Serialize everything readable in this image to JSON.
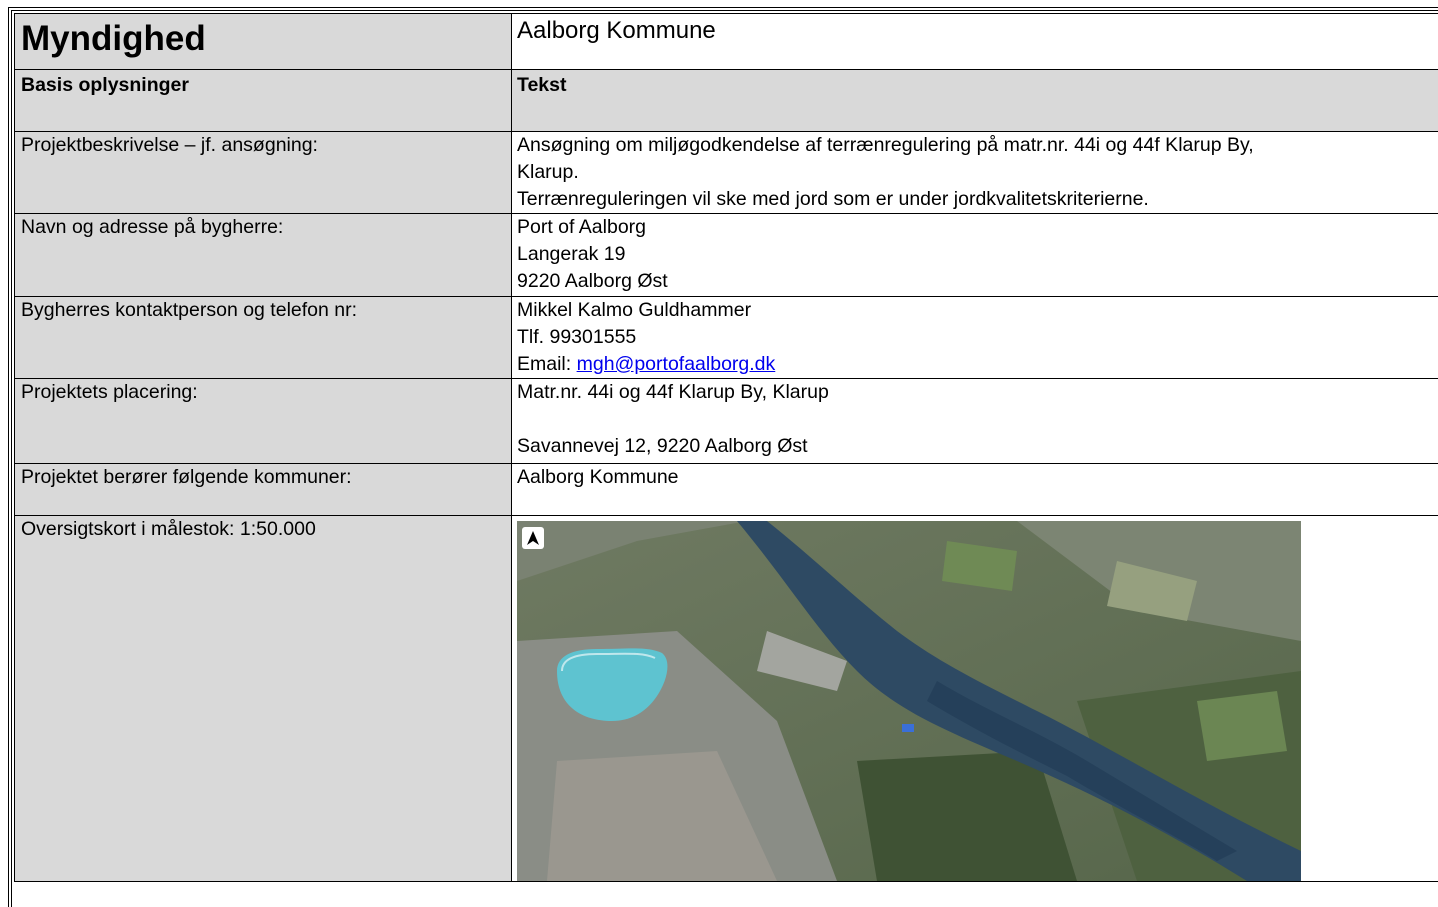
{
  "header": {
    "authority_label": "Myndighed",
    "authority_value": "Aalborg Kommune"
  },
  "subheader": {
    "left": "Basis oplysninger",
    "right": "Tekst"
  },
  "rows": {
    "description": {
      "label": "Projektbeskrivelse – jf. ansøgning:",
      "lines": [
        "Ansøgning om miljøgodkendelse af terrænregulering på matr.nr. 44i og 44f Klarup By,",
        "Klarup.",
        "Terrænreguleringen vil ske med jord som er under jordkvalitetskriterierne."
      ]
    },
    "developer": {
      "label": "Navn og adresse på bygherre:",
      "lines": [
        "Port of Aalborg",
        "Langerak 19",
        "9220 Aalborg Øst"
      ]
    },
    "contact": {
      "label": "Bygherres kontaktperson og telefon nr:",
      "name": "Mikkel Kalmo Guldhammer",
      "phone": "Tlf. 99301555",
      "email_label": "Email: ",
      "email": "mgh@portofaalborg.dk"
    },
    "placement": {
      "label": "Projektets placering:",
      "line1": "Matr.nr. 44i og 44f Klarup By, Klarup",
      "line2": "Savannevej 12, 9220 Aalborg Øst"
    },
    "municipalities": {
      "label": "Projektet berører følgende kommuner:",
      "value": "Aalborg Kommune"
    },
    "map": {
      "label": "Oversigtskort i målestok: 1:50.000"
    }
  },
  "colors": {
    "label_bg": "#d9d9d9",
    "link": "#0000ee",
    "water": "#2e4a63",
    "lake": "#5ec3d0"
  },
  "icons": [
    "north-arrow-icon"
  ]
}
